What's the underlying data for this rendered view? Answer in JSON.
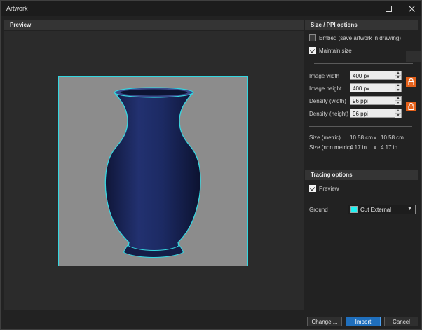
{
  "window": {
    "title": "Artwork",
    "maximize_icon": "maximize-icon",
    "close_icon": "close-icon"
  },
  "preview": {
    "header": "Preview"
  },
  "size_options": {
    "header": "Size / PPI options",
    "embed_label": "Embed (save artwork in drawing)",
    "embed_checked": false,
    "maintain_label": "Maintain size",
    "maintain_checked": true,
    "fields": [
      {
        "label": "Image width",
        "value": "400 px"
      },
      {
        "label": "Image height",
        "value": "400 px"
      },
      {
        "label": "Density (width)",
        "value": "96 ppi"
      },
      {
        "label": "Density (height)",
        "value": "96 ppi"
      }
    ],
    "metric_label": "Size (metric)",
    "metric_w": "10.58 cm",
    "metric_x": "x",
    "metric_h": "10.58 cm",
    "nonmetric_label": "Size (non metric)",
    "nonmetric_w": "4.17 in",
    "nonmetric_x": "x",
    "nonmetric_h": "4.17 in"
  },
  "tracing": {
    "header": "Tracing options",
    "preview_label": "Preview",
    "preview_checked": true,
    "ground_label": "Ground",
    "ground_value": "Cut External",
    "ground_color": "#1ff2f2"
  },
  "buttons": {
    "change": "Change ...",
    "import": "Import",
    "cancel": "Cancel"
  },
  "colors": {
    "accent": "#1f6fbd",
    "lock": "#e5611a",
    "outline": "#35d6e0",
    "vase": "#1c2a63"
  }
}
